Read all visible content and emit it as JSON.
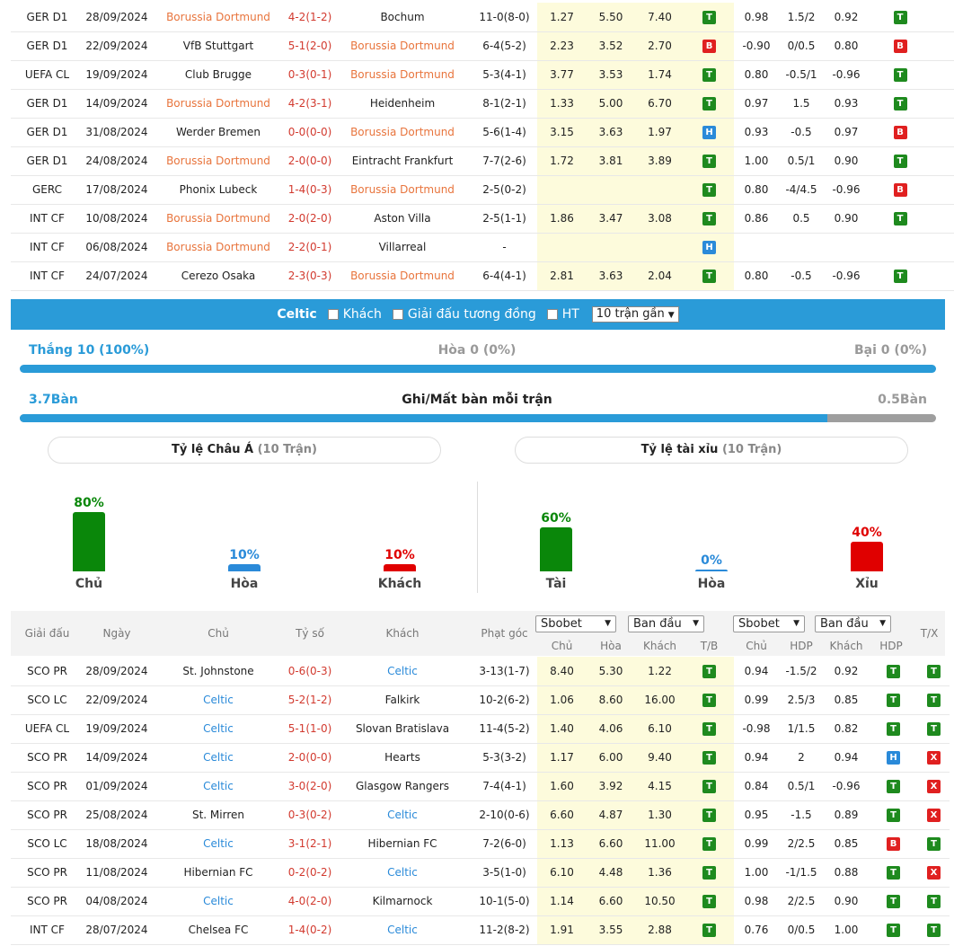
{
  "home_team": "Borussia Dortmund",
  "away_team": "Celtic",
  "top_rows": [
    {
      "league": "GER D1",
      "date": "28/09/2024",
      "home": "Borussia Dortmund",
      "score": "4-2(1-2)",
      "away": "Bochum",
      "corner": "11-0(8-0)",
      "o1": "1.27",
      "o2": "5.50",
      "o3": "7.40",
      "r1": "T",
      "h1": "0.98",
      "h2": "1.5/2",
      "h3": "0.92",
      "r2": "T",
      "r3": "T",
      "hh": true,
      "ah": false
    },
    {
      "league": "GER D1",
      "date": "22/09/2024",
      "home": "VfB Stuttgart",
      "score": "5-1(2-0)",
      "away": "Borussia Dortmund",
      "corner": "6-4(5-2)",
      "o1": "2.23",
      "o2": "3.52",
      "o3": "2.70",
      "r1": "B",
      "h1": "-0.90",
      "h2": "0/0.5",
      "h3": "0.80",
      "r2": "B",
      "r3": "T",
      "hh": false,
      "ah": true
    },
    {
      "league": "UEFA CL",
      "date": "19/09/2024",
      "home": "Club Brugge",
      "score": "0-3(0-1)",
      "away": "Borussia Dortmund",
      "corner": "5-3(4-1)",
      "o1": "3.77",
      "o2": "3.53",
      "o3": "1.74",
      "r1": "T",
      "h1": "0.80",
      "h2": "-0.5/1",
      "h3": "-0.96",
      "r2": "T",
      "r3": "T",
      "hh": false,
      "ah": true
    },
    {
      "league": "GER D1",
      "date": "14/09/2024",
      "home": "Borussia Dortmund",
      "score": "4-2(3-1)",
      "away": "Heidenheim",
      "corner": "8-1(2-1)",
      "o1": "1.33",
      "o2": "5.00",
      "o3": "6.70",
      "r1": "T",
      "h1": "0.97",
      "h2": "1.5",
      "h3": "0.93",
      "r2": "T",
      "r3": "T",
      "hh": true,
      "ah": false
    },
    {
      "league": "GER D1",
      "date": "31/08/2024",
      "home": "Werder Bremen",
      "score": "0-0(0-0)",
      "away": "Borussia Dortmund",
      "corner": "5-6(1-4)",
      "o1": "3.15",
      "o2": "3.63",
      "o3": "1.97",
      "r1": "H",
      "h1": "0.93",
      "h2": "-0.5",
      "h3": "0.97",
      "r2": "B",
      "r3": "X",
      "hh": false,
      "ah": true
    },
    {
      "league": "GER D1",
      "date": "24/08/2024",
      "home": "Borussia Dortmund",
      "score": "2-0(0-0)",
      "away": "Eintracht Frankfurt",
      "corner": "7-7(2-6)",
      "o1": "1.72",
      "o2": "3.81",
      "o3": "3.89",
      "r1": "T",
      "h1": "1.00",
      "h2": "0.5/1",
      "h3": "0.90",
      "r2": "T",
      "r3": "X",
      "hh": true,
      "ah": false
    },
    {
      "league": "GERC",
      "date": "17/08/2024",
      "home": "Phonix Lubeck",
      "score": "1-4(0-3)",
      "away": "Borussia Dortmund",
      "corner": "2-5(0-2)",
      "o1": "",
      "o2": "",
      "o3": "",
      "r1": "T",
      "h1": "0.80",
      "h2": "-4/4.5",
      "h3": "-0.96",
      "r2": "B",
      "r3": "H",
      "hh": false,
      "ah": true
    },
    {
      "league": "INT CF",
      "date": "10/08/2024",
      "home": "Borussia Dortmund",
      "score": "2-0(2-0)",
      "away": "Aston Villa",
      "corner": "2-5(1-1)",
      "o1": "1.86",
      "o2": "3.47",
      "o3": "3.08",
      "r1": "T",
      "h1": "0.86",
      "h2": "0.5",
      "h3": "0.90",
      "r2": "T",
      "r3": "X",
      "hh": true,
      "ah": false
    },
    {
      "league": "INT CF",
      "date": "06/08/2024",
      "home": "Borussia Dortmund",
      "score": "2-2(0-1)",
      "away": "Villarreal",
      "corner": "-",
      "o1": "",
      "o2": "",
      "o3": "",
      "r1": "H",
      "h1": "",
      "h2": "",
      "h3": "",
      "r2": "",
      "r3": "",
      "hh": true,
      "ah": false
    },
    {
      "league": "INT CF",
      "date": "24/07/2024",
      "home": "Cerezo Osaka",
      "score": "2-3(0-3)",
      "away": "Borussia Dortmund",
      "corner": "6-4(4-1)",
      "o1": "2.81",
      "o2": "3.63",
      "o3": "2.04",
      "r1": "T",
      "h1": "0.80",
      "h2": "-0.5",
      "h3": "-0.96",
      "r2": "T",
      "r3": "T",
      "hh": false,
      "ah": true
    }
  ],
  "filter": {
    "team": "Celtic",
    "opt1": "Khách",
    "opt2": "Giải đấu tương đồng",
    "opt3": "HT",
    "select": "10 trận gần"
  },
  "summary": {
    "win": "Thắng 10 (100%)",
    "draw": "Hòa 0 (0%)",
    "loss": "Bại 0 (0%)",
    "win_fraction": 1.0
  },
  "goals": {
    "for": "3.7Bàn",
    "title": "Ghi/Mất bàn mỗi trận",
    "against": "0.5Bàn",
    "for_value": 3.7,
    "against_value": 0.5
  },
  "asia": {
    "title": "Tỷ lệ Châu Á",
    "sub": "(10 Trận)",
    "items": [
      {
        "pct": "80%",
        "label": "Chủ",
        "value": 80,
        "color": "#0a870a"
      },
      {
        "pct": "10%",
        "label": "Hòa",
        "value": 10,
        "color": "#2a8ad9"
      },
      {
        "pct": "10%",
        "label": "Khách",
        "value": 10,
        "color": "#e00000"
      }
    ]
  },
  "ou": {
    "title": "Tỷ lệ tài xỉu",
    "sub": "(10 Trận)",
    "items": [
      {
        "pct": "60%",
        "label": "Tài",
        "value": 60,
        "color": "#0a870a"
      },
      {
        "pct": "0%",
        "label": "Hòa",
        "value": 0,
        "color": "#2a8ad9"
      },
      {
        "pct": "40%",
        "label": "Xỉu",
        "value": 40,
        "color": "#e00000"
      }
    ]
  },
  "header": {
    "league": "Giải đấu",
    "date": "Ngày",
    "home": "Chủ",
    "score": "Tỷ số",
    "away": "Khách",
    "corner": "Phạt góc",
    "sel1": "Sbobet",
    "sel2": "Ban đầu",
    "sel3": "Sbobet",
    "sel4": "Ban đầu",
    "c1": "Chủ",
    "c2": "Hòa",
    "c3": "Khách",
    "c4": "T/B",
    "c5": "Chủ",
    "c6": "HDP",
    "c7": "Khách",
    "c8": "HDP",
    "tx": "T/X"
  },
  "bottom_rows": [
    {
      "league": "SCO PR",
      "date": "28/09/2024",
      "home": "St. Johnstone",
      "score": "0-6(0-3)",
      "away": "Celtic",
      "corner": "3-13(1-7)",
      "o1": "8.40",
      "o2": "5.30",
      "o3": "1.22",
      "r1": "T",
      "h1": "0.94",
      "h2": "-1.5/2",
      "h3": "0.92",
      "r2": "T",
      "r3": "T",
      "hh": false,
      "ah": true
    },
    {
      "league": "SCO LC",
      "date": "22/09/2024",
      "home": "Celtic",
      "score": "5-2(1-2)",
      "away": "Falkirk",
      "corner": "10-2(6-2)",
      "o1": "1.06",
      "o2": "8.60",
      "o3": "16.00",
      "r1": "T",
      "h1": "0.99",
      "h2": "2.5/3",
      "h3": "0.85",
      "r2": "T",
      "r3": "T",
      "hh": true,
      "ah": false
    },
    {
      "league": "UEFA CL",
      "date": "19/09/2024",
      "home": "Celtic",
      "score": "5-1(1-0)",
      "away": "Slovan Bratislava",
      "corner": "11-4(5-2)",
      "o1": "1.40",
      "o2": "4.06",
      "o3": "6.10",
      "r1": "T",
      "h1": "-0.98",
      "h2": "1/1.5",
      "h3": "0.82",
      "r2": "T",
      "r3": "T",
      "hh": true,
      "ah": false
    },
    {
      "league": "SCO PR",
      "date": "14/09/2024",
      "home": "Celtic",
      "score": "2-0(0-0)",
      "away": "Hearts",
      "corner": "5-3(3-2)",
      "o1": "1.17",
      "o2": "6.00",
      "o3": "9.40",
      "r1": "T",
      "h1": "0.94",
      "h2": "2",
      "h3": "0.94",
      "r2": "H",
      "r3": "X",
      "hh": true,
      "ah": false
    },
    {
      "league": "SCO PR",
      "date": "01/09/2024",
      "home": "Celtic",
      "score": "3-0(2-0)",
      "away": "Glasgow Rangers",
      "corner": "7-4(4-1)",
      "o1": "1.60",
      "o2": "3.92",
      "o3": "4.15",
      "r1": "T",
      "h1": "0.84",
      "h2": "0.5/1",
      "h3": "-0.96",
      "r2": "T",
      "r3": "X",
      "hh": true,
      "ah": false
    },
    {
      "league": "SCO PR",
      "date": "25/08/2024",
      "home": "St. Mirren",
      "score": "0-3(0-2)",
      "away": "Celtic",
      "corner": "2-10(0-6)",
      "o1": "6.60",
      "o2": "4.87",
      "o3": "1.30",
      "r1": "T",
      "h1": "0.95",
      "h2": "-1.5",
      "h3": "0.89",
      "r2": "T",
      "r3": "X",
      "hh": false,
      "ah": true
    },
    {
      "league": "SCO LC",
      "date": "18/08/2024",
      "home": "Celtic",
      "score": "3-1(2-1)",
      "away": "Hibernian FC",
      "corner": "7-2(6-0)",
      "o1": "1.13",
      "o2": "6.60",
      "o3": "11.00",
      "r1": "T",
      "h1": "0.99",
      "h2": "2/2.5",
      "h3": "0.85",
      "r2": "B",
      "r3": "T",
      "hh": true,
      "ah": false
    },
    {
      "league": "SCO PR",
      "date": "11/08/2024",
      "home": "Hibernian FC",
      "score": "0-2(0-2)",
      "away": "Celtic",
      "corner": "3-5(1-0)",
      "o1": "6.10",
      "o2": "4.48",
      "o3": "1.36",
      "r1": "T",
      "h1": "1.00",
      "h2": "-1/1.5",
      "h3": "0.88",
      "r2": "T",
      "r3": "X",
      "hh": false,
      "ah": true
    },
    {
      "league": "SCO PR",
      "date": "04/08/2024",
      "home": "Celtic",
      "score": "4-0(2-0)",
      "away": "Kilmarnock",
      "corner": "10-1(5-0)",
      "o1": "1.14",
      "o2": "6.60",
      "o3": "10.50",
      "r1": "T",
      "h1": "0.98",
      "h2": "2/2.5",
      "h3": "0.90",
      "r2": "T",
      "r3": "T",
      "hh": true,
      "ah": false
    },
    {
      "league": "INT CF",
      "date": "28/07/2024",
      "home": "Chelsea FC",
      "score": "1-4(0-2)",
      "away": "Celtic",
      "corner": "11-2(8-2)",
      "o1": "1.91",
      "o2": "3.55",
      "o3": "2.88",
      "r1": "T",
      "h1": "0.76",
      "h2": "0/0.5",
      "h3": "1.00",
      "r2": "T",
      "r3": "T",
      "hh": false,
      "ah": true
    }
  ]
}
